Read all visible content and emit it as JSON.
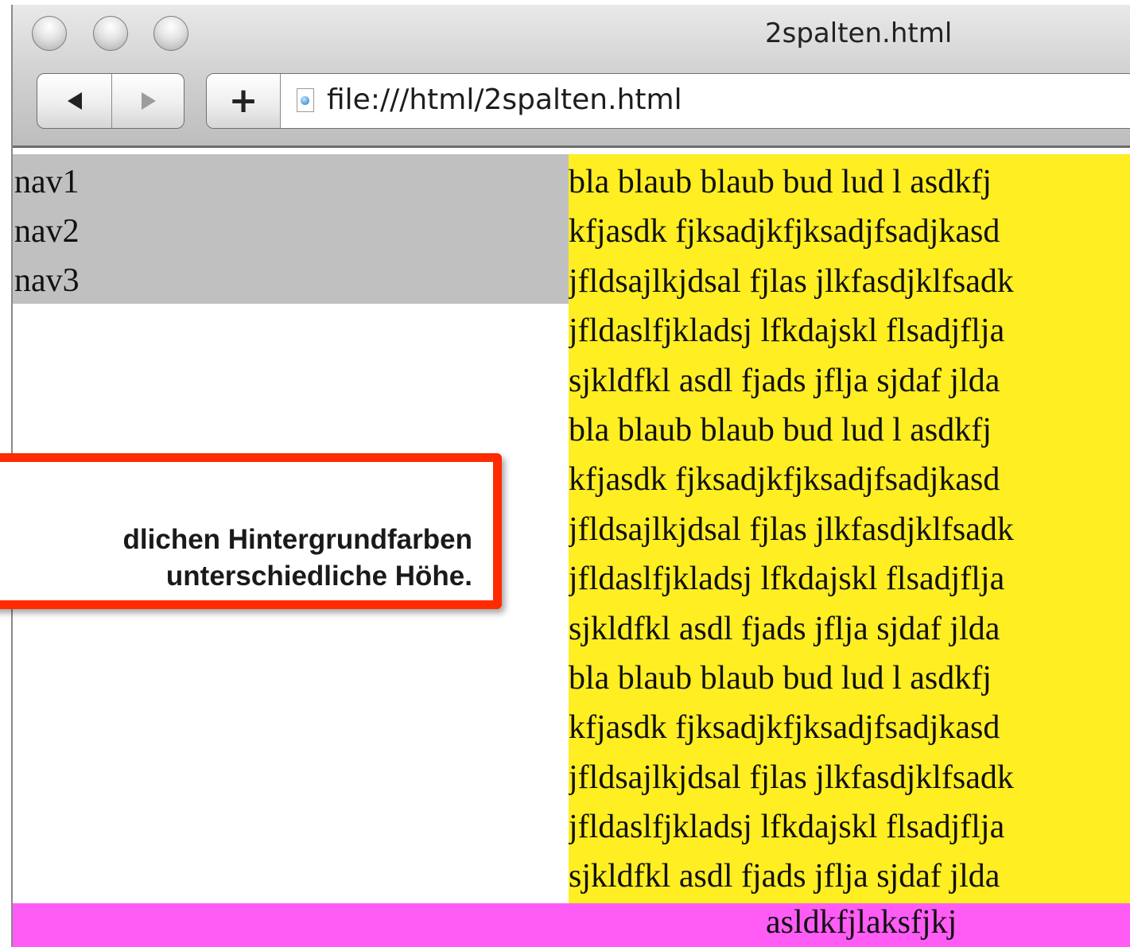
{
  "browser": {
    "window_title": "2spalten.html",
    "url": "file:///html/2spalten.html",
    "new_tab_label": "+"
  },
  "page": {
    "nav_items": [
      "nav1",
      "nav2",
      "nav3"
    ],
    "main_lines": [
      "bla blaub blaub bud lud l asdkfj",
      "kfjasdk fjksadjkfjksadjfsadjkasd",
      "jfldsajlkjdsal fjlas jlkfasdjklfsadk",
      "jfldaslfjkladsj lfkdajskl flsadjflja",
      "sjkldfkl asdl fjads jflja sjdaf jlda",
      "bla blaub blaub bud lud l asdkfj",
      "kfjasdk fjksadjkfjksadjfsadjkasd",
      "jfldsajlkjdsal fjlas jlkfasdjklfsadk",
      "jfldaslfjkladsj lfkdajskl flsadjflja",
      "sjkldfkl asdl fjads jflja sjdaf jlda",
      "bla blaub blaub bud lud l asdkfj",
      "kfjasdk fjksadjkfjksadjfsadjkasd",
      "jfldsajlkjdsal fjlas jlkfasdjklfsadk",
      "jfldaslfjkladsj lfkdajskl flsadjflja",
      "sjkldfkl asdl fjads jflja sjdaf jlda"
    ],
    "footer_text": "asldkfjlaksfjkj"
  },
  "callout": {
    "line1": "dlichen Hintergrundfarben",
    "line2": "unterschiedliche Höhe."
  },
  "colors": {
    "nav_background": "#c0c0c0",
    "main_background": "#ffee22",
    "footer_background": "#ff5cf6",
    "callout_border": "#ff2a00"
  }
}
